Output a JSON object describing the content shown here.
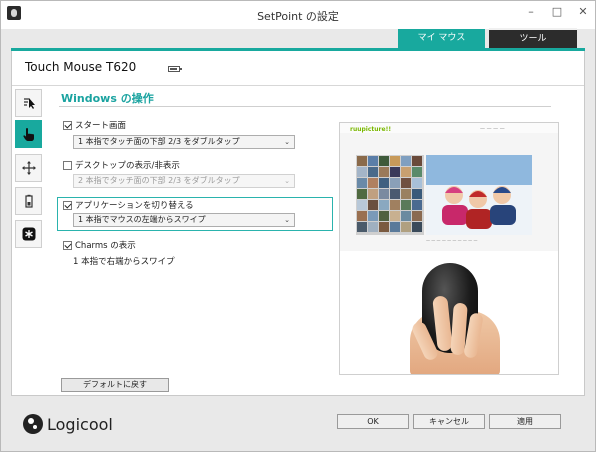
{
  "window": {
    "title": "SetPoint の設定",
    "min_glyph": "–",
    "max_glyph": "□",
    "close_glyph": "✕"
  },
  "tabs": {
    "active_label": "マイ マウス",
    "inactive_label": "ツール"
  },
  "device": {
    "name": "Touch Mouse T620",
    "battery_icon": "battery-icon"
  },
  "sidebar": {
    "items": [
      {
        "icon": "pointer-speed-icon",
        "active": false
      },
      {
        "icon": "hand-touch-icon",
        "active": true
      },
      {
        "icon": "move-arrows-icon",
        "active": false
      },
      {
        "icon": "battery-icon",
        "active": false
      },
      {
        "icon": "asterisk-icon",
        "active": false
      }
    ]
  },
  "section": {
    "title": "Windows の操作"
  },
  "options": {
    "start_screen": {
      "label": "スタート画面",
      "checked": true,
      "select_value": "1 本指でタッチ面の下部 2/3 をダブルタップ"
    },
    "desktop_toggle": {
      "label": "デスクトップの表示/非表示",
      "checked": false,
      "select_value": "2 本指でタッチ面の下部 2/3 をダブルタップ"
    },
    "app_switch": {
      "label": "アプリケーションを切り替える",
      "checked": true,
      "select_value": "1 本指でマウスの左端からスワイプ"
    },
    "charms": {
      "label": "Charms の表示",
      "checked": true,
      "description": "1 本指で右端からスワイプ"
    }
  },
  "buttons": {
    "restore_defaults": "デフォルトに戻す",
    "ok": "OK",
    "cancel": "キャンセル",
    "apply": "適用"
  },
  "preview": {
    "site_logo": "ruupicture!!"
  },
  "brand": {
    "logo_text": "Logicool"
  },
  "colors": {
    "accent": "#18a99e",
    "dark_tab": "#2c2c2c"
  }
}
